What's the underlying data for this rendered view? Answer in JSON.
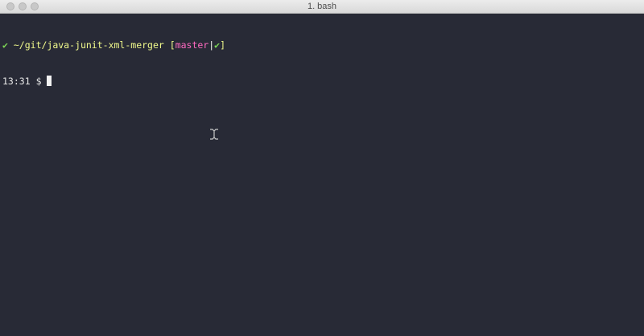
{
  "window": {
    "title": "1. bash"
  },
  "terminal": {
    "line1": {
      "status_symbol": "✔",
      "path": "~/git/java-junit-xml-merger",
      "bracket_open": "[",
      "branch": "master",
      "separator": "|",
      "clean_symbol": "✔",
      "bracket_close": "]"
    },
    "line2": {
      "time": "13:31",
      "prompt": "$"
    }
  },
  "colors": {
    "background": "#282a36",
    "status_ok": "#7ed957",
    "path": "#f1fa8c",
    "branch": "#ff6ac1",
    "text": "#e6e6e6"
  },
  "icons": {
    "mouse": "ibeam-cursor-icon"
  }
}
